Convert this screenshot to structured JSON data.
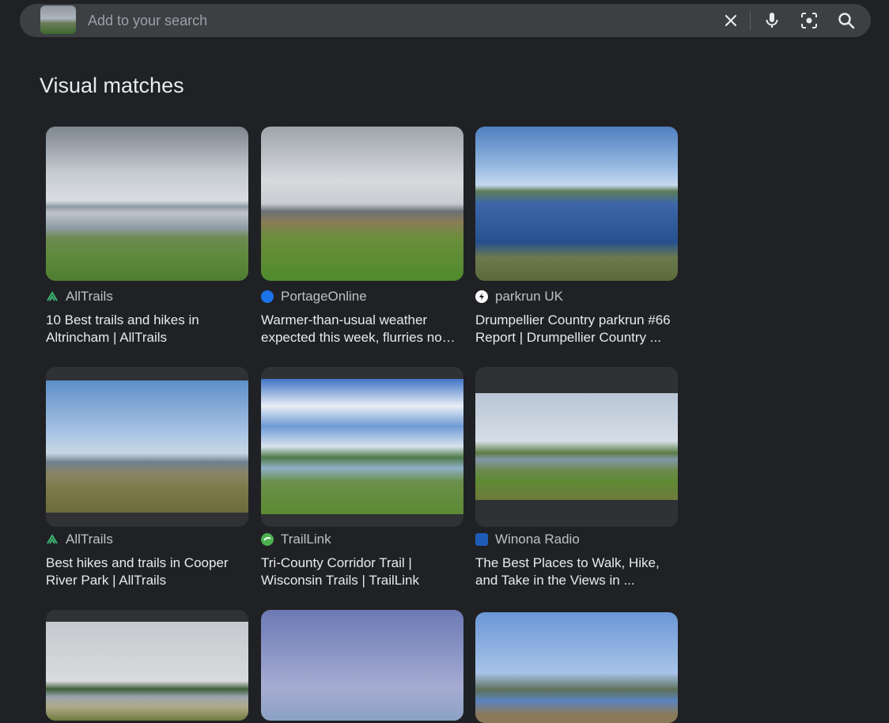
{
  "search": {
    "placeholder": "Add to your search"
  },
  "icons": {
    "clear": "close-icon",
    "voice": "microphone-icon",
    "lens": "lens-camera-icon",
    "search": "search-icon"
  },
  "section_title": "Visual matches",
  "results": [
    {
      "source": "AllTrails",
      "title": "10 Best trails and hikes in Altrincham | AllTrails",
      "favicon_color": "#3cb371"
    },
    {
      "source": "PortageOnline",
      "title": "Warmer-than-usual weather expected this week, flurries no…",
      "favicon_color": "#1a73e8"
    },
    {
      "source": "parkrun UK",
      "title": "Drumpellier Country parkrun #66 Report | Drumpellier Country ...",
      "favicon_color": "#ffffff"
    },
    {
      "source": "AllTrails",
      "title": "Best hikes and trails in Cooper River Park | AllTrails",
      "favicon_color": "#3cb371"
    },
    {
      "source": "TrailLink",
      "title": "Tri-County Corridor Trail | Wisconsin Trails | TrailLink",
      "favicon_color": "#4caf50"
    },
    {
      "source": "Winona Radio",
      "title": "The Best Places to Walk, Hike, and Take in the Views in ...",
      "favicon_color": "#1e5bb8"
    },
    {
      "source": "",
      "title": ""
    },
    {
      "source": "",
      "title": ""
    },
    {
      "source": "",
      "title": ""
    }
  ]
}
